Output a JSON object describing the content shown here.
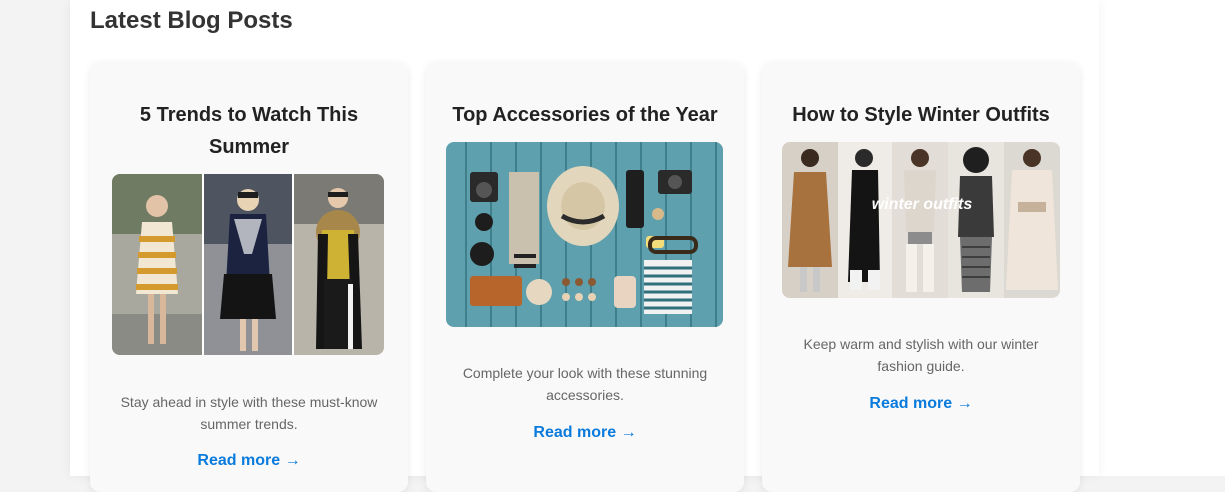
{
  "section": {
    "title": "Latest Blog Posts"
  },
  "posts": [
    {
      "title_line1": "5 Trends to Watch This",
      "title_line2": "Summer",
      "description_line1": "Stay ahead in style with these must-know",
      "description_line2": "summer trends.",
      "link_label": "Read more →",
      "image_kind": "street-style-collage"
    },
    {
      "title_line1": "Top Accessories of the Year",
      "description_line1": "Complete your look with these stunning",
      "description_line2": "accessories.",
      "link_label": "Read more →",
      "image_kind": "accessories-flatlay"
    },
    {
      "title_line1": "How to Style Winter Outfits",
      "image_overlay": "winter outfits",
      "description_line1": "Keep warm and stylish with our winter",
      "description_line2": "fashion guide.",
      "link_label": "Read more →",
      "image_kind": "winter-outfits-collage"
    }
  ],
  "colors": {
    "link": "#0a7bdc",
    "card_bg": "#f9f9f9",
    "title": "#222222",
    "muted": "#666666"
  }
}
